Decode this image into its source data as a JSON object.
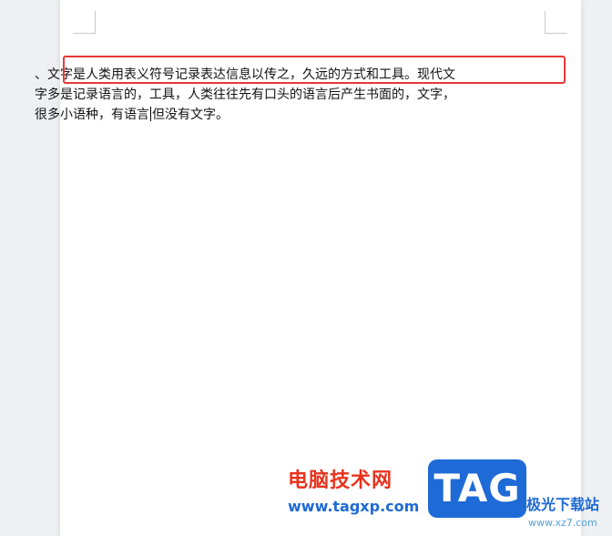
{
  "document": {
    "lines": [
      "、文字是人类用表义符号记录表达信息以传之，久远的方式和工具。现代文",
      "字多是记录语言的，工具，人类往往先有口头的语言后产生书面的，文字，",
      "很多小语种，有语言",
      "但没有文字。"
    ]
  },
  "watermark": {
    "site_name": "电脑技术网",
    "site_url": "www.tagxp.com",
    "tag_logo": "TAG",
    "xz_name": "极光下载站",
    "xz_url": "www.xz7.com"
  },
  "colors": {
    "highlight_border": "#e53935",
    "watermark_red": "#e8321e",
    "watermark_blue": "#1e6ad6"
  }
}
